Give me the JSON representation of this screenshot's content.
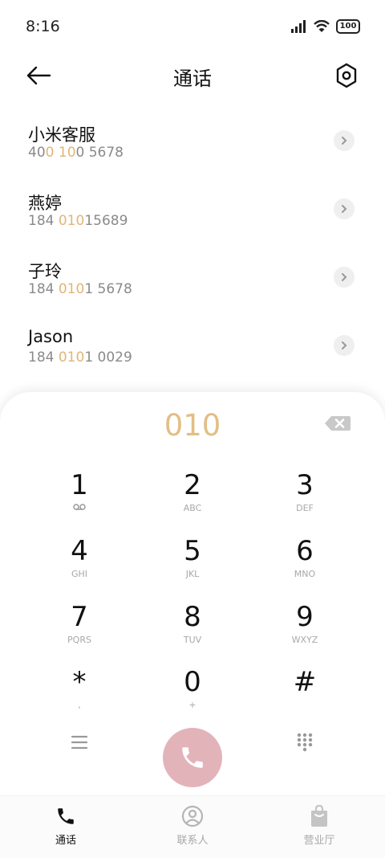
{
  "status_bar": {
    "time": "8:16",
    "battery": "100"
  },
  "header": {
    "title": "通话"
  },
  "contacts": [
    {
      "name": "小米客服",
      "number_parts": [
        {
          "text": "40",
          "hl": false
        },
        {
          "text": "0",
          "hl": true
        },
        {
          "text": " ",
          "hl": false
        },
        {
          "text": "10",
          "hl": true
        },
        {
          "text": "0 5678",
          "hl": false
        }
      ]
    },
    {
      "name": "燕婷",
      "number_parts": [
        {
          "text": "184 ",
          "hl": false
        },
        {
          "text": "010",
          "hl": true
        },
        {
          "text": "15689",
          "hl": false
        }
      ]
    },
    {
      "name": "子玲",
      "number_parts": [
        {
          "text": "184 ",
          "hl": false
        },
        {
          "text": "010",
          "hl": true
        },
        {
          "text": "1 5678",
          "hl": false
        }
      ]
    },
    {
      "name": "Jason",
      "number_parts": [
        {
          "text": "184 ",
          "hl": false
        },
        {
          "text": "010",
          "hl": true
        },
        {
          "text": "1 0029",
          "hl": false
        }
      ]
    }
  ],
  "dialer": {
    "entered": "010",
    "keys": [
      {
        "digit": "1",
        "sub": ""
      },
      {
        "digit": "2",
        "sub": "ABC"
      },
      {
        "digit": "3",
        "sub": "DEF"
      },
      {
        "digit": "4",
        "sub": "GHI"
      },
      {
        "digit": "5",
        "sub": "JKL"
      },
      {
        "digit": "6",
        "sub": "MNO"
      },
      {
        "digit": "7",
        "sub": "PQRS"
      },
      {
        "digit": "8",
        "sub": "TUV"
      },
      {
        "digit": "9",
        "sub": "WXYZ"
      },
      {
        "digit": "*",
        "sub": ","
      },
      {
        "digit": "0",
        "sub": "+"
      },
      {
        "digit": "#",
        "sub": ""
      }
    ]
  },
  "bottom_nav": [
    {
      "label": "通话"
    },
    {
      "label": "联系人"
    },
    {
      "label": "营业厅"
    }
  ],
  "colors": {
    "highlight": "#e1b577",
    "call_button": "#e3b3ba",
    "entered_digits": "#e3be85"
  }
}
